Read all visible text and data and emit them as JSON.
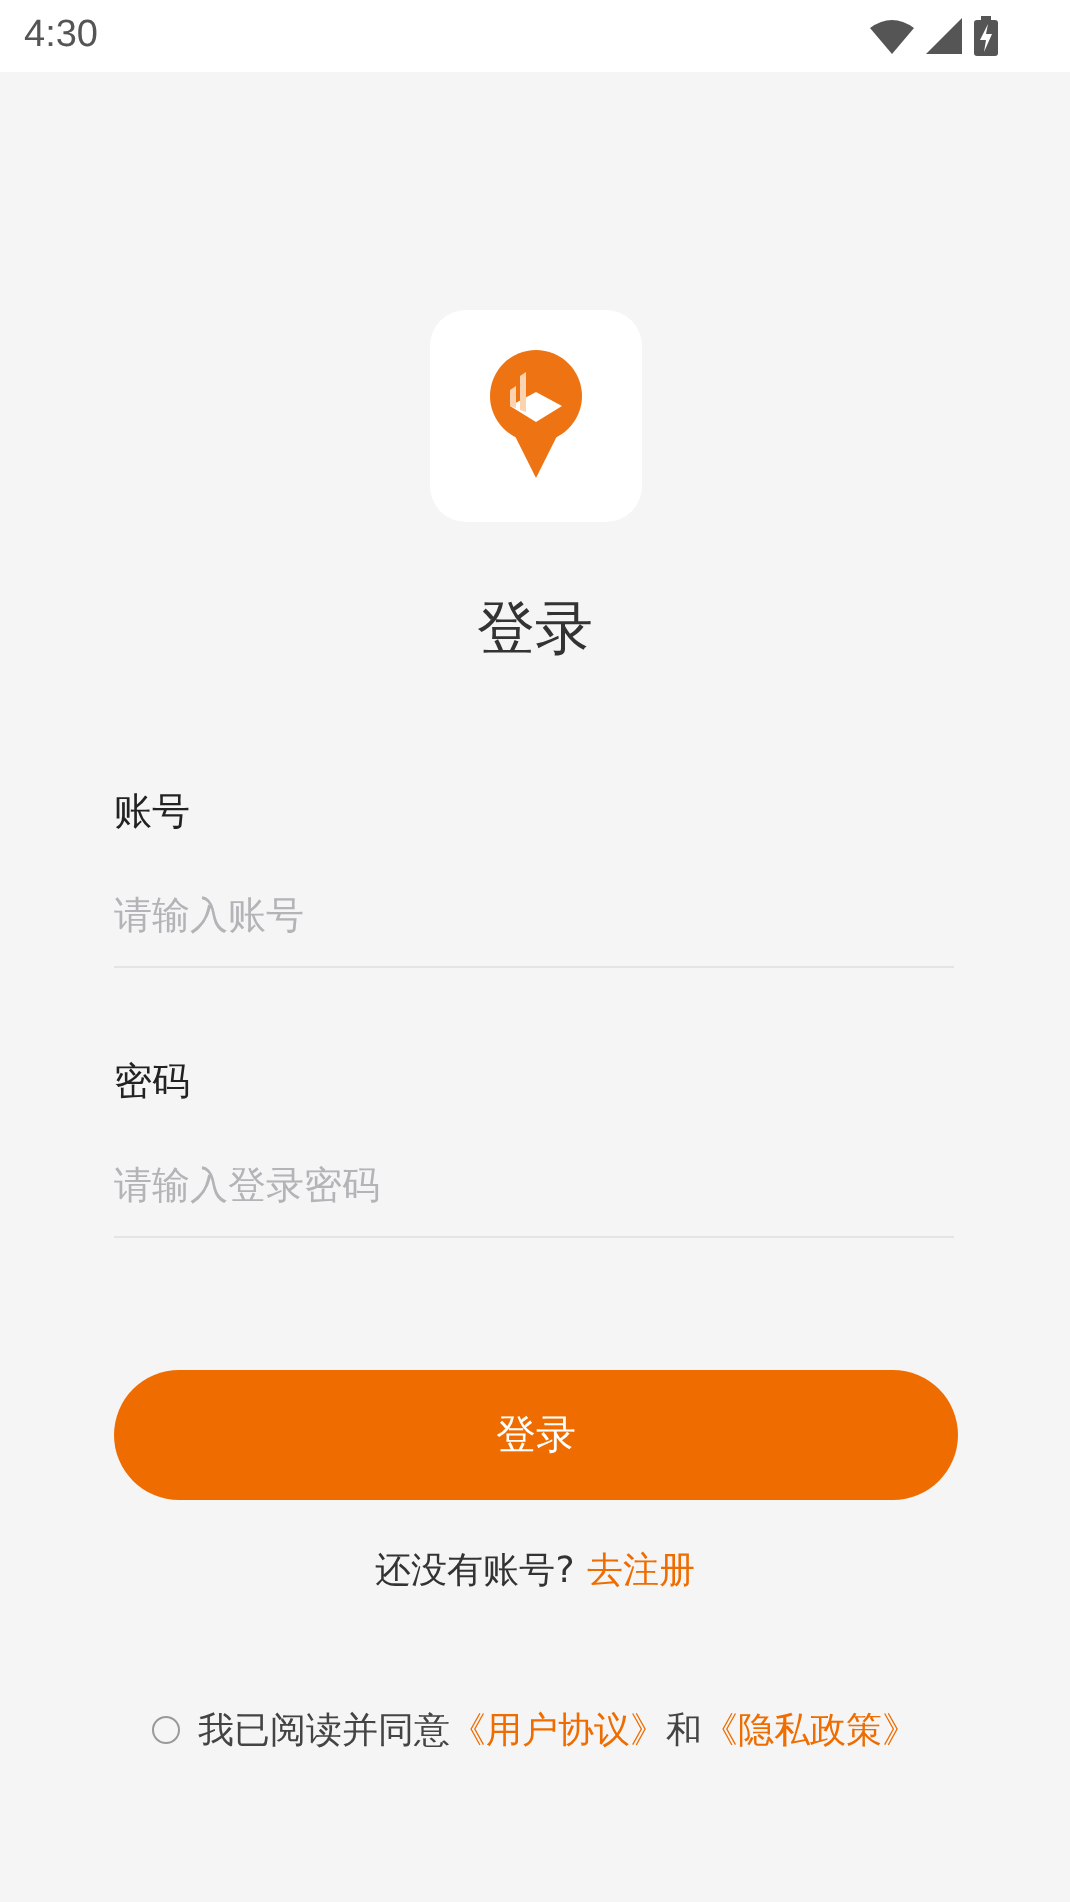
{
  "status_bar": {
    "time": "4:30"
  },
  "title": "登录",
  "fields": [
    {
      "label": "账号",
      "placeholder": "请输入账号"
    },
    {
      "label": "密码",
      "placeholder": "请输入登录密码"
    }
  ],
  "login_button": "登录",
  "register": {
    "prompt": "还没有账号?",
    "link": "去注册"
  },
  "agreement": {
    "checked": false,
    "text": "我已阅读并同意",
    "link_1": "《用户协议》",
    "joiner": "和",
    "link_2": "《隐私政策》"
  }
}
